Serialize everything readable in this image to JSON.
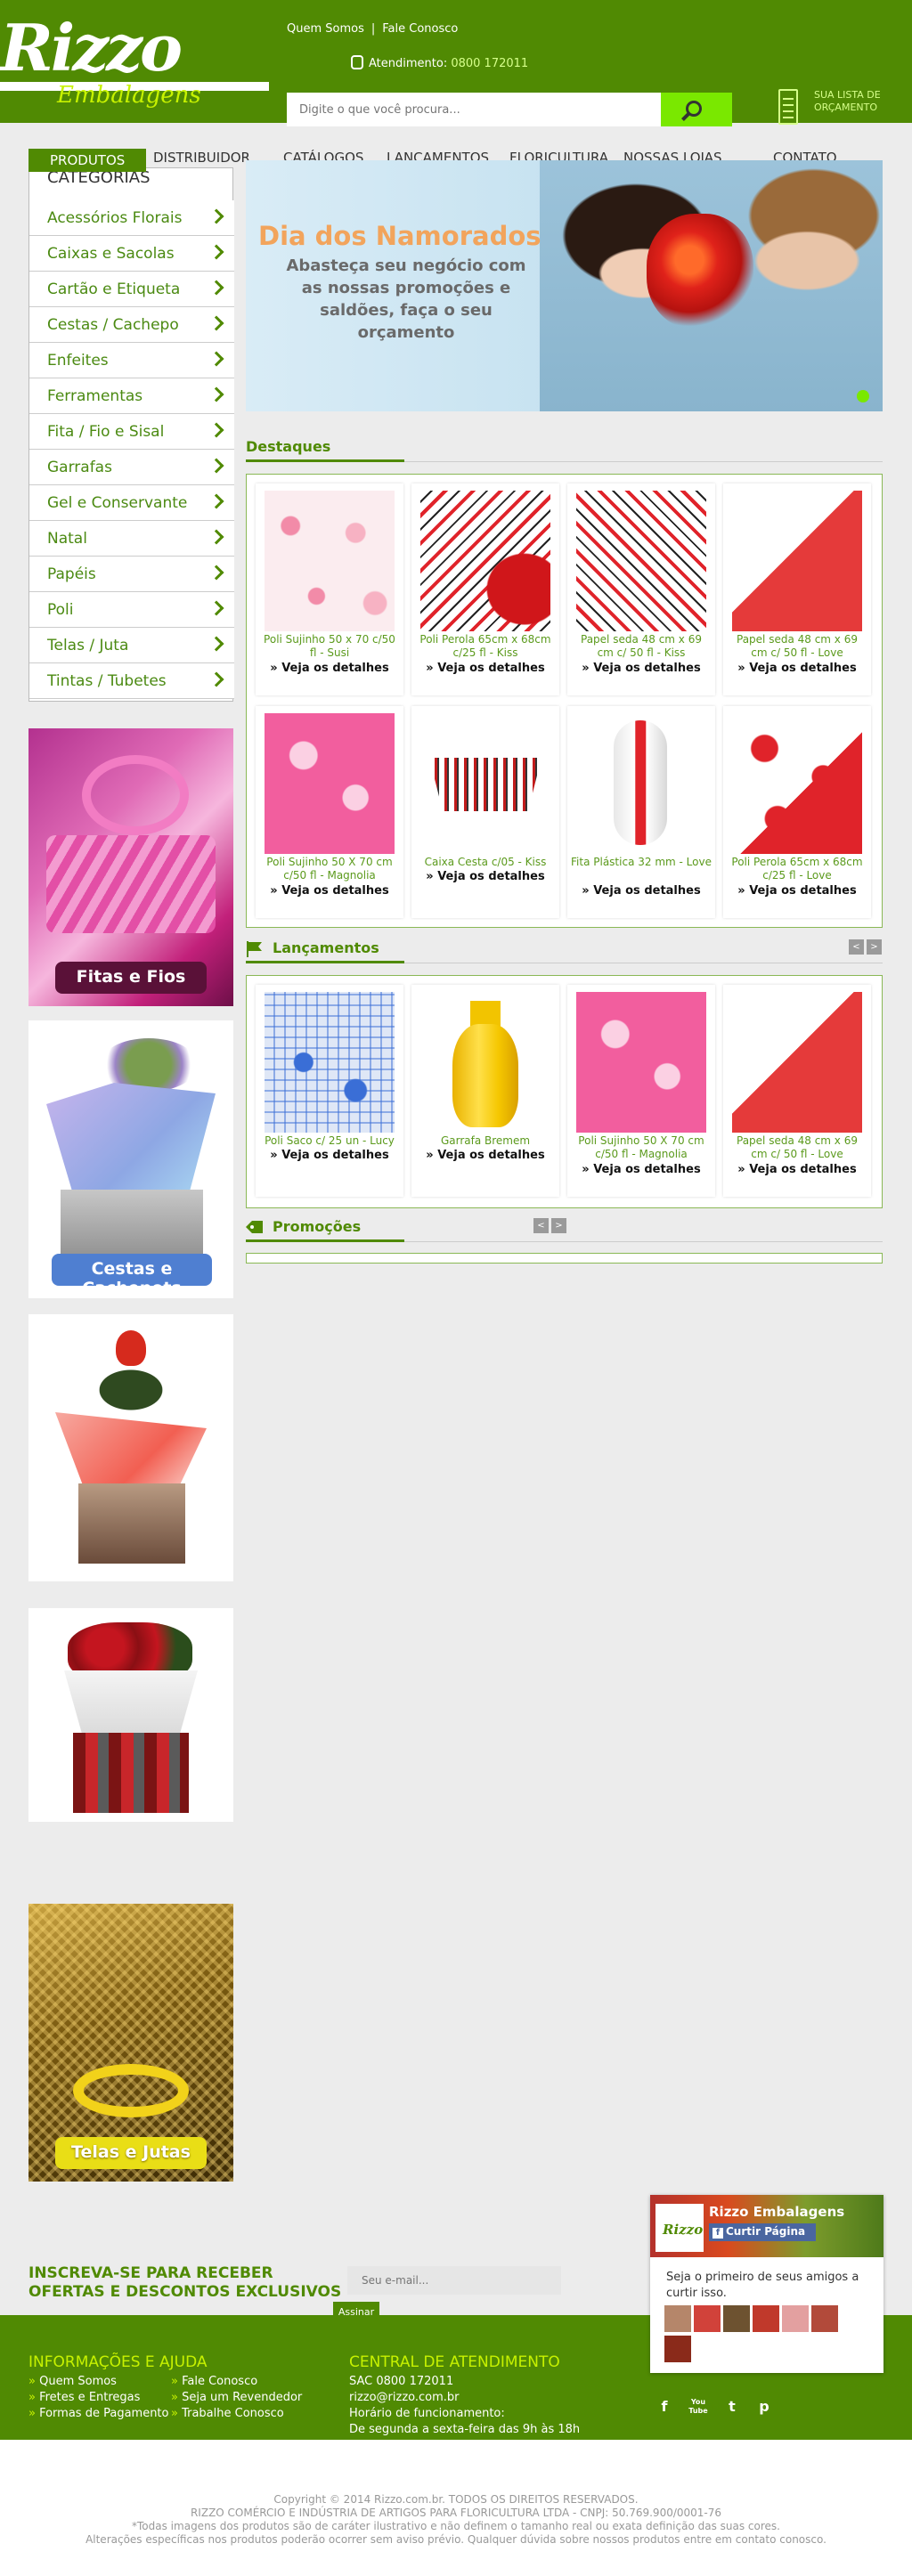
{
  "header": {
    "links": [
      "Quem Somos",
      "Fale Conosco"
    ],
    "logo_text": "Rizzo",
    "logo_sub": "Embalagens",
    "phone_label": "Atendimento:",
    "phone_number": "0800 172011",
    "search_placeholder": "Digite o que você procura...",
    "cart_label": "SUA LISTA DE ORÇAMENTO"
  },
  "nav": [
    "PRODUTOS",
    "DISTRIBUIDOR",
    "CATÁLOGOS",
    "LANÇAMENTOS",
    "FLORICULTURA",
    "NOSSAS LOJAS",
    "CONTATO"
  ],
  "categories": {
    "title": "CATEGORIAS",
    "items": [
      "Acessórios Florais",
      "Caixas e Sacolas",
      "Cartão e Etiqueta",
      "Cestas / Cachepo",
      "Enfeites",
      "Ferramentas",
      "Fita / Fio e Sisal",
      "Garrafas",
      "Gel e Conservante",
      "Natal",
      "Papéis",
      "Poli",
      "Telas / Juta",
      "Tintas / Tubetes"
    ]
  },
  "side_banners": [
    "Fitas e Fios",
    "Cestas e Cachepots",
    "Telas e Jutas"
  ],
  "hero": {
    "title": "Dia dos Namorados",
    "subtitle": "Abasteça seu negócio com as nossas promoções e saldões, faça o seu orçamento"
  },
  "destaques": {
    "title": "Destaques",
    "more_label": "» Veja os detalhes",
    "products": [
      {
        "name": "Poli Sujinho 50 x 70 c/50 fl - Susi"
      },
      {
        "name": "Poli Perola 65cm x 68cm c/25 fl - Kiss"
      },
      {
        "name": "Papel seda 48 cm x 69 cm c/ 50 fl - Kiss"
      },
      {
        "name": "Papel seda 48 cm x 69 cm c/ 50 fl - Love"
      },
      {
        "name": "Poli Sujinho 50 X 70 cm c/50 fl - Magnolia"
      },
      {
        "name": "Caixa Cesta c/05 - Kiss"
      },
      {
        "name": "Fita Plástica 32 mm - Love"
      },
      {
        "name": "Poli Perola 65cm x 68cm c/25 fl - Love"
      }
    ]
  },
  "lancamentos": {
    "title": "Lançamentos",
    "prev": "<",
    "next": ">",
    "products": [
      {
        "name": "Poli Saco c/ 25 un - Lucy"
      },
      {
        "name": "Garrafa Bremem"
      },
      {
        "name": "Poli Sujinho 50 X 70 cm c/50 fl - Magnolia"
      },
      {
        "name": "Papel seda 48 cm x 69 cm c/ 50 fl - Love"
      }
    ]
  },
  "promocoes": {
    "title": "Promoções",
    "prev": "<",
    "next": ">"
  },
  "newsletter": {
    "title": "INSCREVA-SE PARA RECEBER OFERTAS E DESCONTOS EXCLUSIVOS",
    "placeholder": "Seu e-mail...",
    "button": "Assinar"
  },
  "facebook": {
    "name": "Rizzo Embalagens",
    "like": "Curtir Página",
    "text": "Seja o primeiro de seus amigos a curtir isso."
  },
  "info": {
    "title": "INFORMAÇÕES E AJUDA",
    "col1": [
      "Quem Somos",
      "Fretes e Entregas",
      "Formas de Pagamento"
    ],
    "col2": [
      "Fale Conosco",
      "Seja um Revendedor",
      "Trabalhe Conosco"
    ]
  },
  "central": {
    "title": "CENTRAL DE ATENDIMENTO",
    "sac": "SAC 0800 172011",
    "email": "rizzo@rizzo.com.br",
    "hours_label": "Horário de funcionamento:",
    "hours": "De segunda a sexta-feira das 9h às 18h"
  },
  "social": [
    "f",
    "You Tube",
    "t",
    "p"
  ],
  "footer": {
    "copyright": "Copyright © 2014 Rizzo.com.br. TODOS OS DIREITOS RESERVADOS.",
    "company": "RIZZO COMÉRCIO E INDÚSTRIA DE ARTIGOS PARA FLORICULTURA LTDA - CNPJ: 50.769.900/0001-76",
    "disclaimer1": "*Todas imagens dos produtos são de caráter ilustrativo e não definem o tamanho real ou exata definição das suas cores.",
    "disclaimer2": "Alterações específicas nos produtos poderão ocorrer sem aviso prévio. Qualquer dúvida sobre nossos produtos entre em contato conosco."
  }
}
